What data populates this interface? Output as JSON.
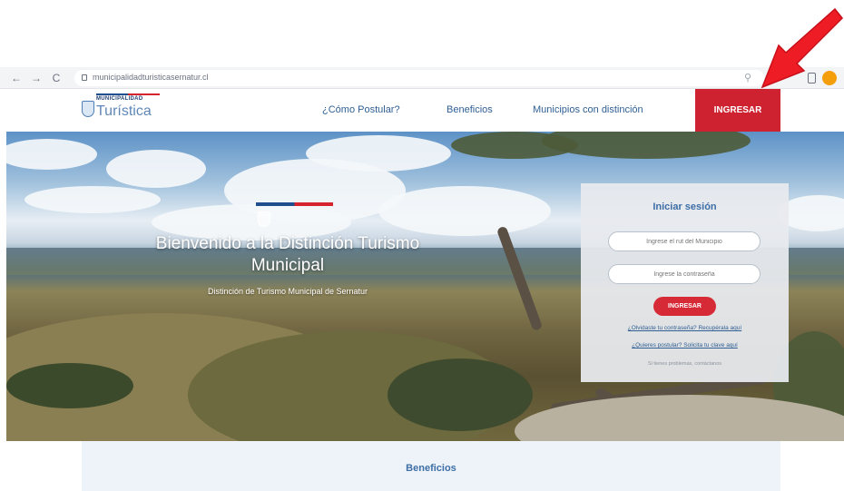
{
  "browser": {
    "back": "←",
    "forward": "→",
    "reload": "C",
    "url": "municipalidadturisticasernatur.cl",
    "zoom_icon": "magnifier-icon"
  },
  "header": {
    "logo_top": "MUNICIPALIDAD",
    "logo_name": "Turística",
    "menu": [
      "¿Cómo Postular?",
      "Beneficios",
      "Municipios con distinción"
    ],
    "cta": "INGRESAR"
  },
  "hero": {
    "title": "Bienvenido a la Distinción Turismo Municipal",
    "subtitle": "Distinción de Turismo Municipal de Sernatur"
  },
  "login": {
    "title": "Iniciar sesión",
    "rut_placeholder": "Ingrese el rut del Municipio",
    "password_placeholder": "Ingrese la contraseña",
    "submit": "INGRESAR",
    "link_forgot": "¿Olvidaste tu contraseña? Recupérala aquí",
    "link_register": "¿Quieres postular? Solicita tu clave aquí",
    "note": "Si tienes problemas, contáctanos"
  },
  "section": {
    "title": "Beneficios"
  },
  "colors": {
    "brand_blue": "#2f5f94",
    "brand_red": "#cf2230",
    "annotation_arrow": "#ee1c24"
  }
}
